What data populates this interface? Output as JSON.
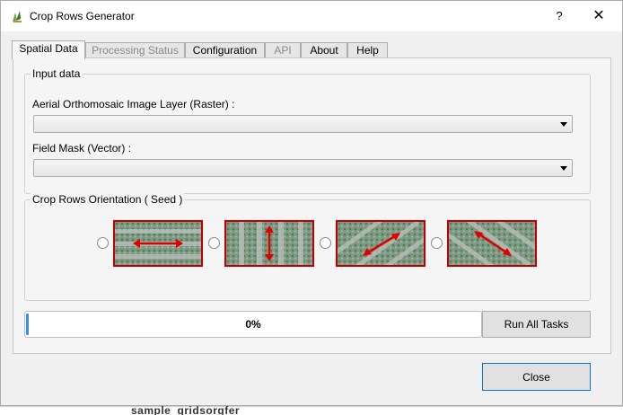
{
  "window": {
    "title": "Crop Rows Generator",
    "help_label": "?",
    "close_label": "✕"
  },
  "tabs": [
    {
      "label": "Spatial Data",
      "active": true,
      "enabled": true
    },
    {
      "label": "Processing Status",
      "active": false,
      "enabled": false
    },
    {
      "label": "Configuration",
      "active": false,
      "enabled": true
    },
    {
      "label": "API",
      "active": false,
      "enabled": false
    },
    {
      "label": "About",
      "active": false,
      "enabled": true
    },
    {
      "label": "Help",
      "active": false,
      "enabled": true
    }
  ],
  "input_data": {
    "group_title": "Input data",
    "raster_label": "Aerial Orthomosaic Image Layer (Raster) :",
    "raster_value": "",
    "vector_label": "Field Mask (Vector) :",
    "vector_value": ""
  },
  "orientation": {
    "group_title": "Crop Rows Orientation ( Seed )",
    "options": [
      {
        "name": "horizontal",
        "selected": false,
        "arrow_icon": "horizontal-double-arrow-icon"
      },
      {
        "name": "vertical",
        "selected": false,
        "arrow_icon": "vertical-double-arrow-icon"
      },
      {
        "name": "diagonal-up",
        "selected": false,
        "arrow_icon": "diagonal-up-double-arrow-icon"
      },
      {
        "name": "diagonal-down",
        "selected": false,
        "arrow_icon": "diagonal-down-double-arrow-icon"
      }
    ]
  },
  "progress": {
    "value": 0,
    "label": "0%"
  },
  "buttons": {
    "run_all_tasks": "Run All Tasks",
    "close": "Close"
  },
  "background": {
    "bottom_text": "sample_gridsorgfer"
  },
  "colors": {
    "accent": "#0078d7",
    "progress_fill": "#3a8ee6",
    "thumb_border": "#c00000",
    "arrow": "#e00000"
  }
}
